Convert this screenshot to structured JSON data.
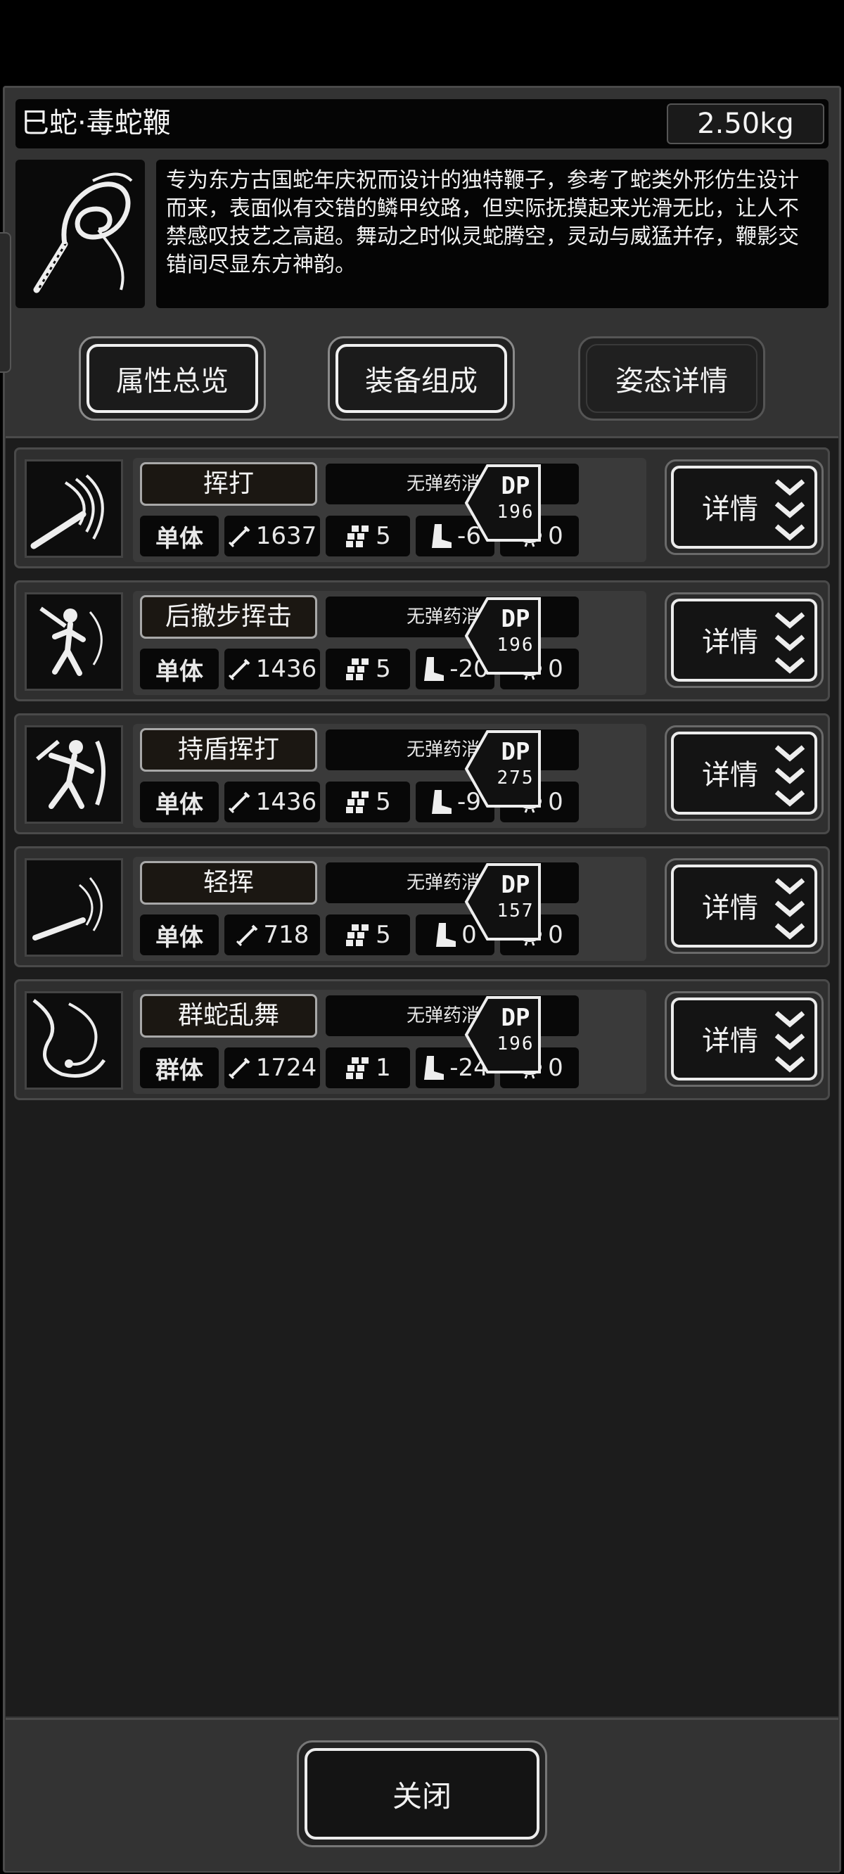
{
  "weapon": {
    "name": "巳蛇·毒蛇鞭",
    "weight": "2.50kg",
    "description": "专为东方古国蛇年庆祝而设计的独特鞭子，参考了蛇类外形仿生设计而来，表面似有交错的鳞甲纹路，但实际抚摸起来光滑无比，让人不禁感叹技艺之高超。舞动之时似灵蛇腾空，灵动与威猛并存，鞭影交错间尽显东方神韵。",
    "image_icon": "snake-whip-icon"
  },
  "tabs": [
    {
      "label": "属性总览",
      "state": "active"
    },
    {
      "label": "装备组成",
      "state": "active"
    },
    {
      "label": "姿态详情",
      "state": "inactive"
    }
  ],
  "skills": [
    {
      "name": "挥打",
      "ammo": "无弹药消耗",
      "target": "单体",
      "attack": "1637",
      "hit": "5",
      "move": "-6",
      "sanity": "0",
      "dp_label": "DP",
      "dp": "196",
      "detail": "详情",
      "icon": "whip-swing-icon"
    },
    {
      "name": "后撤步挥击",
      "ammo": "无弹药消耗",
      "target": "单体",
      "attack": "1436",
      "hit": "5",
      "move": "-20",
      "sanity": "0",
      "dp_label": "DP",
      "dp": "196",
      "detail": "详情",
      "icon": "backstep-strike-icon"
    },
    {
      "name": "持盾挥打",
      "ammo": "无弹药消耗",
      "target": "单体",
      "attack": "1436",
      "hit": "5",
      "move": "-9",
      "sanity": "0",
      "dp_label": "DP",
      "dp": "275",
      "detail": "详情",
      "icon": "shield-strike-icon"
    },
    {
      "name": "轻挥",
      "ammo": "无弹药消耗",
      "target": "单体",
      "attack": "718",
      "hit": "5",
      "move": "0",
      "sanity": "0",
      "dp_label": "DP",
      "dp": "157",
      "detail": "详情",
      "icon": "light-swing-icon"
    },
    {
      "name": "群蛇乱舞",
      "ammo": "无弹药消耗",
      "target": "群体",
      "attack": "1724",
      "hit": "1",
      "move": "-24",
      "sanity": "0",
      "dp_label": "DP",
      "dp": "196",
      "detail": "详情",
      "icon": "snake-dance-icon"
    }
  ],
  "footer": {
    "close_label": "关闭"
  }
}
